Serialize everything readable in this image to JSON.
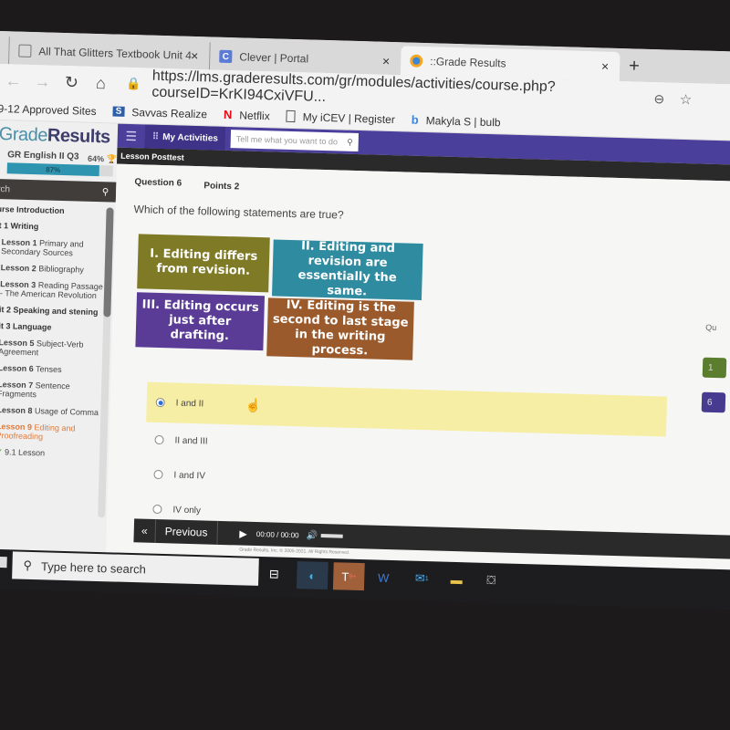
{
  "browser": {
    "tabs": [
      {
        "title": "All That Glitters Textbook Unit 4",
        "icon": "document-icon"
      },
      {
        "title": "Clever | Portal",
        "icon": "clever-icon"
      },
      {
        "title": "::Grade Results",
        "icon": "graderesults-icon",
        "active": true
      }
    ],
    "close_glyph": "×",
    "new_tab_glyph": "+",
    "back_glyph": "←",
    "forward_glyph": "→",
    "reload_glyph": "↻",
    "home_glyph": "⌂",
    "url": "https://lms.graderesults.com/gr/modules/activities/course.php?courseID=KrKI94CxiVFU...",
    "zoom_glyph": "⊖",
    "favorite_glyph": "☆",
    "bookmarks": [
      {
        "label": "9-12 Approved Sites",
        "icon": ""
      },
      {
        "label": "Savvas Realize",
        "icon": "savvas-icon"
      },
      {
        "label": "Netflix",
        "icon": "netflix-icon"
      },
      {
        "label": "My iCEV | Register",
        "icon": "document-icon"
      },
      {
        "label": "Makyla S | bulb",
        "icon": "bulb-icon"
      }
    ]
  },
  "app": {
    "logo_a": "Grade",
    "logo_b": "Results",
    "course_name": "GR English II Q3",
    "course_score": "64% 🏆",
    "course_progress_percent": 87,
    "course_progress_label": "87%",
    "search_placeholder": "rch",
    "search_glyph": "⚲",
    "nav": [
      {
        "text": "urse Introduction",
        "type": "h"
      },
      {
        "text": "it 1 Writing",
        "type": "h"
      },
      {
        "label": "Lesson 1",
        "text": "Primary and Secondary Sources",
        "type": "lesson",
        "status": "ok"
      },
      {
        "label": "Lesson 2",
        "text": "Bibliography",
        "type": "lesson",
        "status": "cur"
      },
      {
        "label": "Lesson 3",
        "text": "Reading Passage - The American Revolution",
        "type": "lesson",
        "status": "ok"
      },
      {
        "text": "nit 2 Speaking and stening",
        "type": "h"
      },
      {
        "text": "nit 3 Language",
        "type": "h"
      },
      {
        "label": "Lesson 5",
        "text": "Subject-Verb Agreement",
        "type": "lesson",
        "status": "bad"
      },
      {
        "label": "Lesson 6",
        "text": "Tenses",
        "type": "lesson",
        "status": "ok"
      },
      {
        "label": "Lesson 7",
        "text": "Sentence Fragments",
        "type": "lesson",
        "status": "ok"
      },
      {
        "label": "Lesson 8",
        "text": "Usage of Comma",
        "type": "lesson",
        "status": "ok"
      },
      {
        "label": "Lesson 9",
        "text": "Editing and Proofreading",
        "type": "lesson",
        "status": "cur",
        "active": true
      },
      {
        "text": "9.1 Lesson",
        "type": "sub",
        "status": "ok"
      }
    ],
    "status_glyphs": {
      "ok": "✔",
      "bad": "✖",
      "cur": "✱"
    },
    "header": {
      "menu_glyph": "☰",
      "grid_glyph": "⠿",
      "my_activities": "My Activities",
      "tellme_placeholder": "Tell me what you want to do",
      "tellme_glyph": "⚲"
    },
    "lesson_title": "Lesson Posttest",
    "question": {
      "number_label": "Question 6",
      "points_label": "Points 2",
      "text": "Which of the following statements are true?",
      "statements": [
        "I. Editing differs from revision.",
        "II. Editing and revision are essentially the same.",
        "III. Editing occurs just after drafting.",
        "IV. Editing is the second to last stage in the writing process."
      ],
      "statement_colors": [
        "#7f7a26",
        "#2f8ba0",
        "#5a3b96",
        "#9a5a2c"
      ],
      "answers": [
        {
          "label": "I and II",
          "selected": true
        },
        {
          "label": "II and III",
          "selected": false
        },
        {
          "label": "I and IV",
          "selected": false
        },
        {
          "label": "IV only",
          "selected": false
        }
      ],
      "selected_highlight": "#f7eea5"
    },
    "footer": {
      "prev_glyph": "«",
      "previous_label": "Previous",
      "play_glyph": "▶",
      "time": "00:00 / 00:00",
      "volume_glyph": "🔊",
      "copyright": "Grade Results, Inc. © 2005-2021. All Rights Reserved."
    },
    "question_nav": {
      "label": "Qu",
      "buttons": [
        "1",
        "6"
      ]
    }
  },
  "taskbar": {
    "search_placeholder": "Type here to search",
    "search_glyph": "⚲",
    "icons": [
      "task-view-icon",
      "edge-icon",
      "teams-icon",
      "word-icon",
      "mail-icon",
      "file-explorer-icon",
      "store-icon"
    ],
    "icon_glyphs": [
      "⊟",
      "◐",
      "T",
      "W",
      "✉",
      "▬",
      "⛋"
    ],
    "teams_badge": "9+",
    "mail_badge": "1"
  },
  "colors": {
    "brand_purple": "#4b3f9c",
    "progress_teal": "#2e94b0",
    "active_lesson": "#e27a3a"
  }
}
